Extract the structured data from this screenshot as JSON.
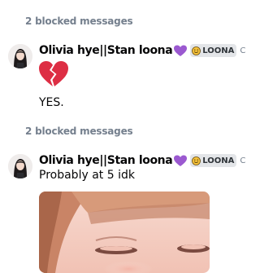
{
  "messages": [
    {
      "blocked_label": "2 blocked messages",
      "author": "Olivia hye||Stan loona",
      "tag": "LOONA",
      "tag_trail": "C",
      "content_emoji": "broken-heart-emoji",
      "text": "YES."
    },
    {
      "blocked_label": "2 blocked messages",
      "author": "Olivia hye||Stan loona",
      "tag": "LOONA",
      "tag_trail": "C",
      "text": "Probably at 5 idk",
      "attachment": "photo"
    }
  ],
  "icons": {
    "author_badge": "purple-heart-icon",
    "tag_badge": "smile-icon"
  },
  "colors": {
    "background": "#ffffff",
    "blocked_text": "#747f8d",
    "tag_bg": "#e3e5e8",
    "purple_heart": "#9b59d0",
    "broken_heart": "#dd2e44"
  }
}
